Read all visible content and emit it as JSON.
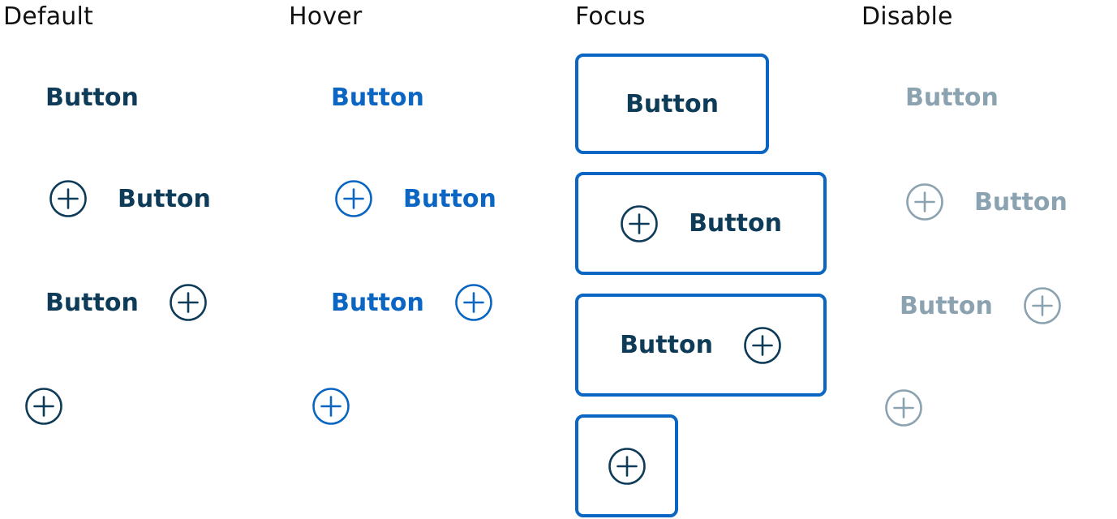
{
  "columns": {
    "default": {
      "title": "Default"
    },
    "hover": {
      "title": "Hover"
    },
    "focus": {
      "title": "Focus"
    },
    "disable": {
      "title": "Disable"
    }
  },
  "button": {
    "label": "Button"
  },
  "icon": {
    "name": "plus-circle-icon"
  },
  "colors": {
    "default": "#0d3b58",
    "hover": "#0a66c2",
    "focus_text": "#0d3b58",
    "focus_border": "#0a66c2",
    "disable": "#8ba2b1"
  }
}
